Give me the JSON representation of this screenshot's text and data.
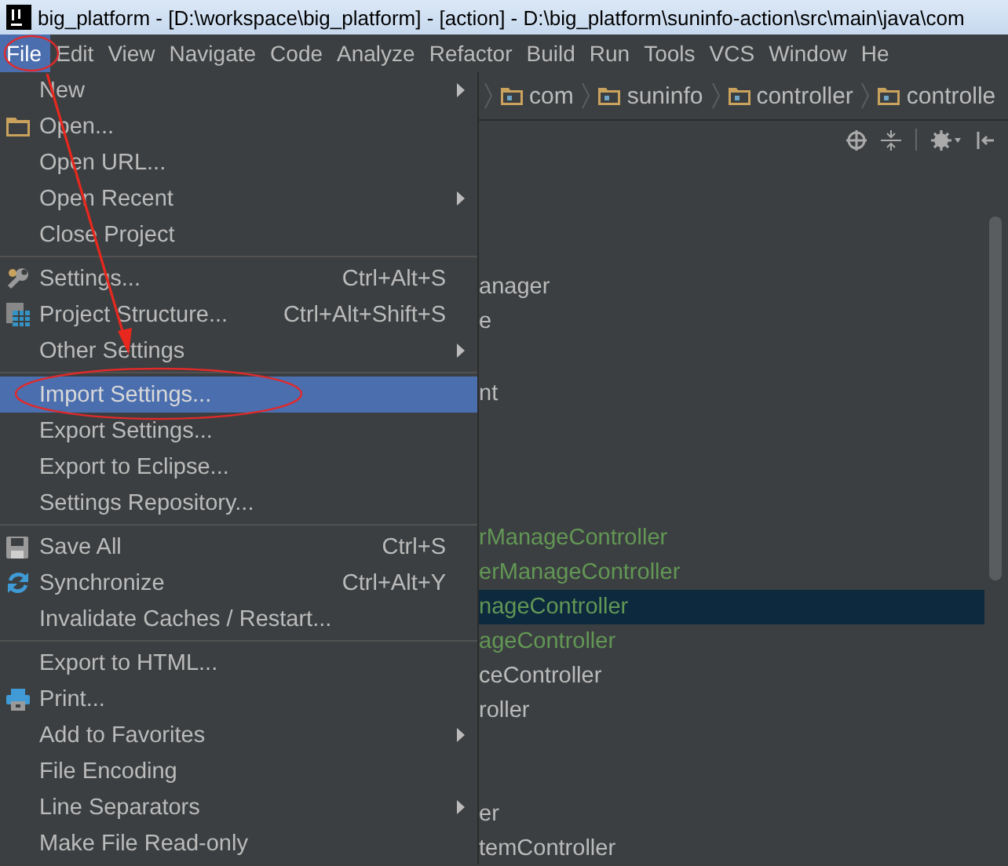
{
  "window": {
    "title": "big_platform - [D:\\workspace\\big_platform] - [action] - D:\\big_platform\\suninfo-action\\src\\main\\java\\com"
  },
  "menubar": [
    {
      "label": "File",
      "selected": true
    },
    {
      "label": "Edit",
      "selected": false
    },
    {
      "label": "View",
      "selected": false
    },
    {
      "label": "Navigate",
      "selected": false
    },
    {
      "label": "Code",
      "selected": false
    },
    {
      "label": "Analyze",
      "selected": false
    },
    {
      "label": "Refactor",
      "selected": false
    },
    {
      "label": "Build",
      "selected": false
    },
    {
      "label": "Run",
      "selected": false
    },
    {
      "label": "Tools",
      "selected": false
    },
    {
      "label": "VCS",
      "selected": false
    },
    {
      "label": "Window",
      "selected": false
    },
    {
      "label": "He",
      "selected": false
    }
  ],
  "breadcrumbs": [
    "com",
    "suninfo",
    "controller",
    "controlle"
  ],
  "file_menu": {
    "groups": [
      [
        {
          "label": "New",
          "kind": "plain",
          "submenu": true,
          "selected": false
        },
        {
          "label": "Open...",
          "kind": "folder",
          "submenu": false,
          "selected": false
        },
        {
          "label": "Open URL...",
          "kind": "plain",
          "submenu": false,
          "selected": false
        },
        {
          "label": "Open Recent",
          "kind": "plain",
          "submenu": true,
          "selected": false
        },
        {
          "label": "Close Project",
          "kind": "plain",
          "submenu": false,
          "selected": false
        }
      ],
      [
        {
          "label": "Settings...",
          "kind": "settings",
          "shortcut": "Ctrl+Alt+S",
          "submenu": false,
          "selected": false
        },
        {
          "label": "Project Structure...",
          "kind": "structure",
          "shortcut": "Ctrl+Alt+Shift+S",
          "submenu": false,
          "selected": false
        },
        {
          "label": "Other Settings",
          "kind": "plain",
          "submenu": true,
          "selected": false
        }
      ],
      [
        {
          "label": "Import Settings...",
          "kind": "plain",
          "submenu": false,
          "selected": true
        },
        {
          "label": "Export Settings...",
          "kind": "plain",
          "submenu": false,
          "selected": false
        },
        {
          "label": "Export to Eclipse...",
          "kind": "plain",
          "submenu": false,
          "selected": false
        },
        {
          "label": "Settings Repository...",
          "kind": "plain",
          "submenu": false,
          "selected": false
        }
      ],
      [
        {
          "label": "Save All",
          "kind": "save",
          "shortcut": "Ctrl+S",
          "submenu": false,
          "selected": false
        },
        {
          "label": "Synchronize",
          "kind": "sync",
          "shortcut": "Ctrl+Alt+Y",
          "submenu": false,
          "selected": false
        },
        {
          "label": "Invalidate Caches / Restart...",
          "kind": "plain",
          "submenu": false,
          "selected": false
        }
      ],
      [
        {
          "label": "Export to HTML...",
          "kind": "plain",
          "submenu": false,
          "selected": false
        },
        {
          "label": "Print...",
          "kind": "print",
          "submenu": false,
          "selected": false
        },
        {
          "label": "Add to Favorites",
          "kind": "plain",
          "submenu": true,
          "selected": false
        },
        {
          "label": "File Encoding",
          "kind": "plain",
          "submenu": false,
          "selected": false
        },
        {
          "label": "Line Separators",
          "kind": "plain",
          "submenu": true,
          "selected": false
        },
        {
          "label": "Make File Read-only",
          "kind": "plain",
          "submenu": false,
          "selected": false
        }
      ]
    ]
  },
  "project_tree": [
    {
      "text": "anager",
      "color": "#bbbbbb",
      "selected": false
    },
    {
      "text": "e",
      "color": "#bbbbbb",
      "selected": false
    },
    {
      "text": "nt",
      "color": "#bbbbbb",
      "selected": false
    },
    {
      "text": "rManageController",
      "color": "#629755",
      "selected": false
    },
    {
      "text": "erManageController",
      "color": "#629755",
      "selected": false
    },
    {
      "text": "nageController",
      "color": "#629755",
      "selected": true
    },
    {
      "text": "ageController",
      "color": "#629755",
      "selected": false
    },
    {
      "text": "ceController",
      "color": "#bbbbbb",
      "selected": false
    },
    {
      "text": "roller",
      "color": "#bbbbbb",
      "selected": false
    },
    {
      "text": "er",
      "color": "#bbbbbb",
      "selected": false
    },
    {
      "text": "temController",
      "color": "#bbbbbb",
      "selected": false
    }
  ]
}
